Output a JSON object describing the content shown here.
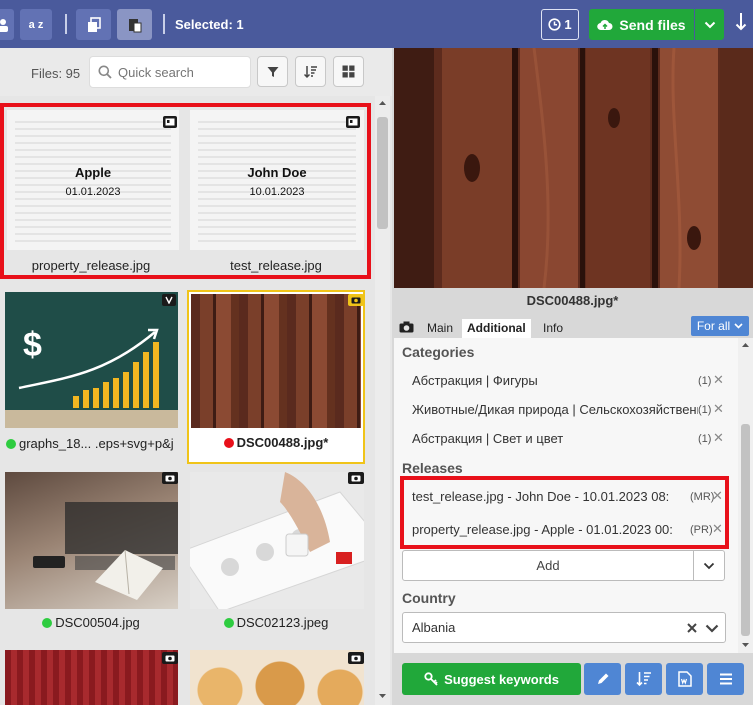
{
  "topbar": {
    "sort_label": "a z",
    "selected": "Selected: 1",
    "history_count": "1",
    "send_label": "Send files"
  },
  "files": {
    "count_label": "Files: 95",
    "search_placeholder": "Quick search",
    "items": [
      {
        "name": "property_release.jpg",
        "release_name": "Apple",
        "release_date": "01.01.2023"
      },
      {
        "name": "test_release.jpg",
        "release_name": "John Doe",
        "release_date": "10.01.2023"
      },
      {
        "name": "graphs_18...    .eps+svg+p&j",
        "status_color": "#2ecc40"
      },
      {
        "name": "DSC00488.jpg*",
        "status_color": "#e8101a"
      },
      {
        "name": "DSC00504.jpg",
        "status_color": "#2ecc40"
      },
      {
        "name": "DSC02123.jpeg",
        "status_color": "#2ecc40"
      }
    ]
  },
  "preview": {
    "title": "DSC00488.jpg*"
  },
  "tabs": {
    "main": "Main",
    "additional": "Additional",
    "info": "Info",
    "for_all": "For all"
  },
  "categories": {
    "label": "Categories",
    "items": [
      {
        "text": "Абстракция | Фигуры",
        "count": "(1)"
      },
      {
        "text": "Животные/Дикая природа | Сельскохозяйственные",
        "count": "(1)"
      },
      {
        "text": "Абстракция | Свет и цвет",
        "count": "(1)"
      }
    ]
  },
  "releases": {
    "label": "Releases",
    "items": [
      {
        "text": "test_release.jpg - John Doe - 10.01.2023 08:",
        "tag": "(MR)"
      },
      {
        "text": "property_release.jpg - Apple - 01.01.2023 00:",
        "tag": "(PR)"
      }
    ],
    "add_label": "Add"
  },
  "country": {
    "label": "Country",
    "value": "Albania"
  },
  "bottom": {
    "suggest_label": "Suggest keywords"
  },
  "colors": {
    "topbar": "#4a5a9c",
    "green": "#21a83a",
    "blue": "#4f86d4",
    "highlight_red": "#e8101a",
    "selected_gold": "#f0c419"
  }
}
